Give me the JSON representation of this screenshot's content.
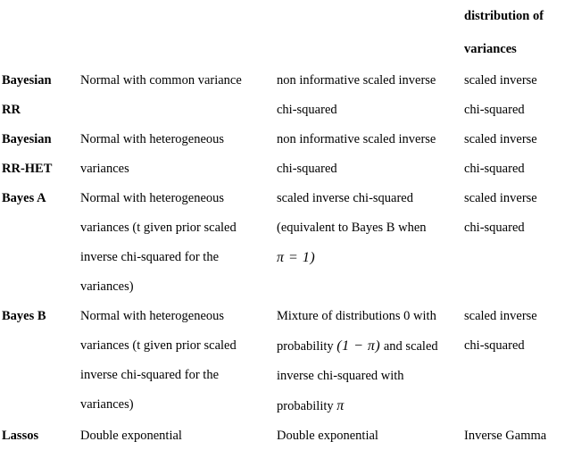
{
  "document": {
    "type": "academic-table",
    "columns": [
      {
        "key": "method",
        "header": ""
      },
      {
        "key": "data_distribution",
        "header": ""
      },
      {
        "key": "prior_distribution",
        "header": ""
      },
      {
        "key": "variance_distribution",
        "header_line1": "distribution of",
        "header_line2": "variances"
      }
    ],
    "header": {
      "col4_line1": "distribution of",
      "col4_line2": "variances"
    },
    "rows": [
      {
        "name": "bayesian-rr",
        "method_lines": [
          "Bayesian",
          "RR"
        ],
        "col2_lines": [
          "Normal with common variance"
        ],
        "col3_lines": [
          "non informative scaled inverse",
          "chi-squared"
        ],
        "col4_lines": [
          "scaled inverse",
          "chi-squared"
        ]
      },
      {
        "name": "bayesian-rr-het",
        "method_lines": [
          "Bayesian",
          "RR-HET"
        ],
        "col2_lines": [
          "Normal with heterogeneous",
          "variances"
        ],
        "col3_lines": [
          "non informative scaled inverse",
          "chi-squared"
        ],
        "col4_lines": [
          "scaled inverse",
          "chi-squared"
        ]
      },
      {
        "name": "bayes-a",
        "method_lines": [
          "Bayes A"
        ],
        "col2_lines": [
          "Normal with heterogeneous",
          "variances (t given prior scaled",
          "inverse chi-squared for the",
          "variances)"
        ],
        "col3_lines": [
          "scaled inverse chi-squared",
          "(equivalent to Bayes B when",
          "MATH_PI_EQ_1"
        ],
        "col3_math": {
          "pi_eq_1": "π = 1)"
        },
        "col4_lines": [
          "scaled inverse",
          "chi-squared"
        ]
      },
      {
        "name": "bayes-b",
        "method_lines": [
          "Bayes B"
        ],
        "col2_lines": [
          "Normal with heterogeneous",
          "variances (t given prior scaled",
          "inverse chi-squared for the",
          "variances)"
        ],
        "col3_lines": [
          "Mixture of distributions 0 with",
          "MATH_PROB_1_MINUS_PI",
          "inverse chi-squared with",
          "MATH_PROB_PI"
        ],
        "col3_math": {
          "prob_1_minus_pi_prefix": "probability",
          "prob_1_minus_pi_expr": "(1 − π)",
          "prob_1_minus_pi_suffix": "and scaled",
          "prob_pi_prefix": "probability",
          "prob_pi_expr": "π"
        },
        "col4_lines": [
          "scaled inverse",
          "chi-squared"
        ]
      },
      {
        "name": "lassos",
        "method_lines": [
          "Lassos"
        ],
        "col2_lines": [
          "Double exponential"
        ],
        "col3_lines": [
          "Double exponential"
        ],
        "col4_lines": [
          "Inverse Gamma"
        ]
      }
    ],
    "style": {
      "rule_color": "#404040",
      "text_color": "#000000",
      "background": "#ffffff"
    }
  }
}
